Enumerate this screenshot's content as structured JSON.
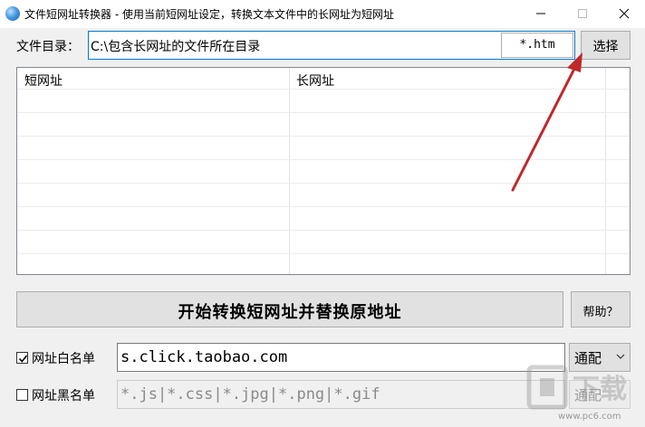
{
  "window": {
    "title": "文件短网址转换器 - 使用当前短网址设定，转换文本文件中的长网址为短网址"
  },
  "directory": {
    "label": "文件目录：",
    "value": "C:\\包含长网址的文件所在目录",
    "extension": "*.htm",
    "select_button": "选择"
  },
  "table": {
    "columns": [
      "短网址",
      "长网址"
    ],
    "rows": []
  },
  "actions": {
    "start_button": "开始转换短网址并替换原地址",
    "help_button": "帮助？"
  },
  "whitelist": {
    "label": "网址白名单",
    "checked": true,
    "value": "s.click.taobao.com",
    "match": "通配"
  },
  "blacklist": {
    "label": "网址黑名单",
    "checked": false,
    "value": "*.js|*.css|*.jpg|*.png|*.gif",
    "match": "通配"
  },
  "watermark": {
    "text": "www.pc6.com"
  },
  "colors": {
    "accent": "#0078d7",
    "arrow": "#c0282a"
  },
  "icons": {
    "app": "globe-icon",
    "minimize": "minimize-icon",
    "maximize": "maximize-icon",
    "close": "close-icon",
    "dropdown": "chevron-down-icon",
    "check": "check-icon"
  }
}
